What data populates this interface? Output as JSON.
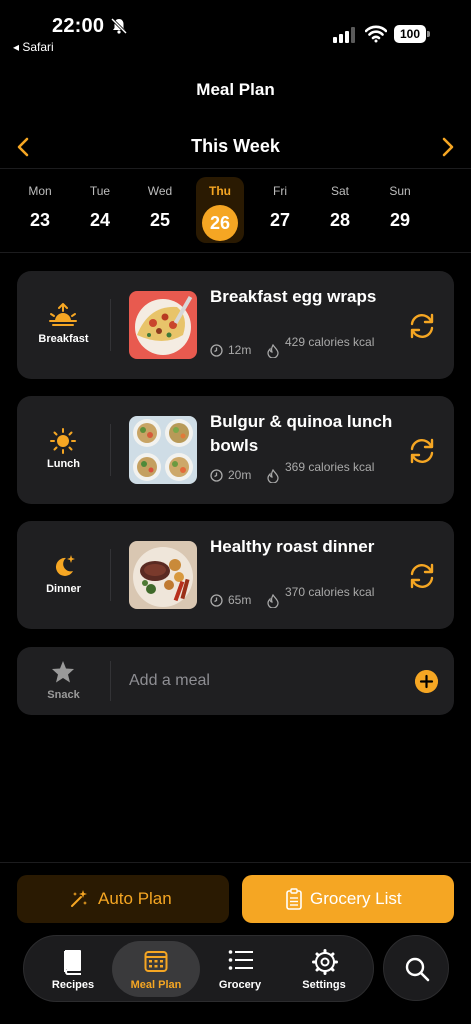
{
  "status_bar": {
    "time": "22:00",
    "back_app": "◂ Safari",
    "battery": "100"
  },
  "header": {
    "title": "Meal Plan"
  },
  "week_nav": {
    "label": "This Week"
  },
  "days": [
    {
      "name": "Mon",
      "num": "23"
    },
    {
      "name": "Tue",
      "num": "24"
    },
    {
      "name": "Wed",
      "num": "25"
    },
    {
      "name": "Thu",
      "num": "26",
      "selected": true
    },
    {
      "name": "Fri",
      "num": "27"
    },
    {
      "name": "Sat",
      "num": "28"
    },
    {
      "name": "Sun",
      "num": "29"
    }
  ],
  "meals": [
    {
      "slot": "Breakfast",
      "slot_icon": "sunrise-icon",
      "title": "Breakfast egg wraps",
      "time": "12m",
      "calories": "429 calories kcal"
    },
    {
      "slot": "Lunch",
      "slot_icon": "sun-icon",
      "title": "Bulgur & quinoa lunch bowls",
      "time": "20m",
      "calories": "369 calories kcal"
    },
    {
      "slot": "Dinner",
      "slot_icon": "moon-icon",
      "title": "Healthy roast dinner",
      "time": "65m",
      "calories": "370 calories kcal"
    }
  ],
  "snack": {
    "slot": "Snack",
    "slot_icon": "star-icon",
    "placeholder": "Add a meal"
  },
  "actions": {
    "auto_plan": "Auto Plan",
    "grocery_list": "Grocery List"
  },
  "tabs": [
    {
      "label": "Recipes",
      "icon": "book-icon"
    },
    {
      "label": "Meal Plan",
      "icon": "calendar-icon",
      "active": true
    },
    {
      "label": "Grocery",
      "icon": "list-icon"
    },
    {
      "label": "Settings",
      "icon": "gear-icon"
    }
  ],
  "colors": {
    "accent": "#f5a623",
    "card": "#1f1f21",
    "background": "#000000"
  }
}
